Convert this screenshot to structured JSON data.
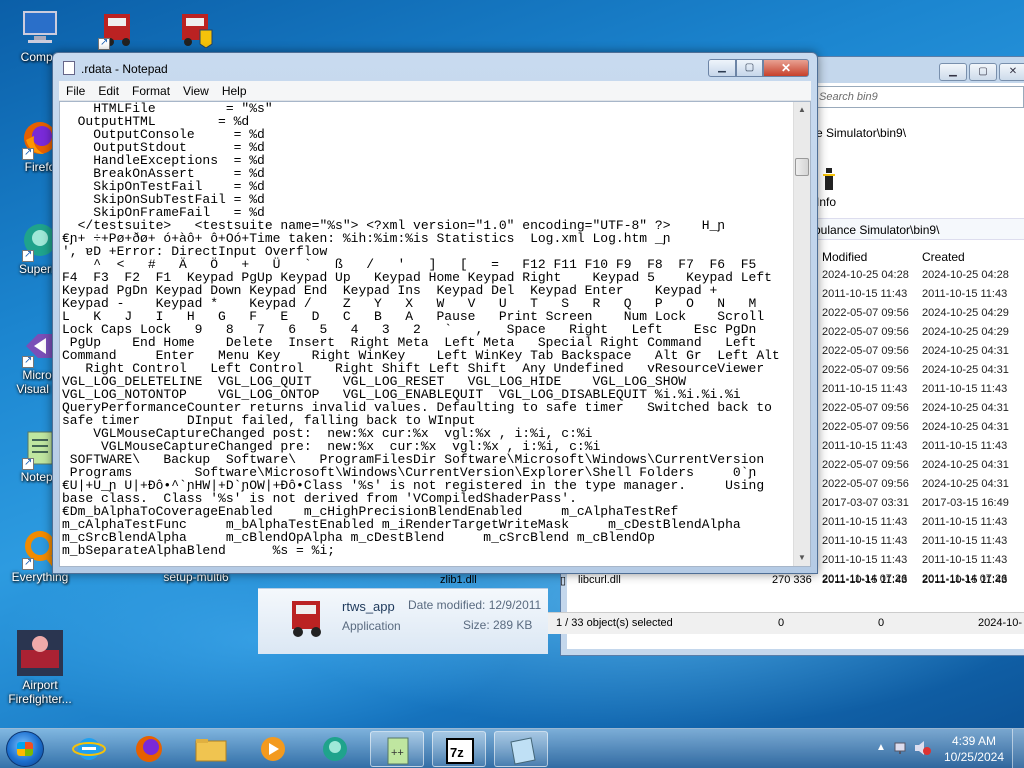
{
  "desktop_icons": [
    {
      "label": "Compu",
      "icon": "computer-icon"
    },
    {
      "label": "Firefo",
      "icon": "firefox-icon"
    },
    {
      "label": "Superm",
      "icon": "app-icon"
    },
    {
      "label": "Micros\nVisual St",
      "icon": "visual-studio-icon"
    },
    {
      "label": "Notepa",
      "icon": "notepad-icon"
    },
    {
      "label": "Everything",
      "icon": "everything-icon"
    },
    {
      "label": "setup-multi6",
      "icon": "setup-icon"
    },
    {
      "label": "Airport\nFirefighter...",
      "icon": "game-icon"
    }
  ],
  "notepad": {
    "title": ".rdata - Notepad",
    "menu": [
      "File",
      "Edit",
      "Format",
      "View",
      "Help"
    ],
    "lines": [
      "    HTMLFile         = \"%s\"",
      "  OutputHTML        = %d",
      "    OutputConsole     = %d",
      "    OutputStdout      = %d",
      "    HandleExceptions  = %d",
      "    BreakOnAssert     = %d",
      "    SkipOnTestFail    = %d",
      "    SkipOnSubTestFail = %d",
      "    SkipOnFrameFail   = %d",
      "  </testsuite>   <testsuite name=\"%s\"> <?xml version=\"1.0\" encoding=\"UTF-8\" ?>    H_ɲ",
      "€ɲ+ ÷+Pø+ðø+ ó+àô+ ô+Oó+Time taken: %ih:%im:%is Statistics  Log.xml Log.htm _ɲ",
      "', ɐD +Error: DirectInput Overflow",
      "    ^  <   #   Ä   Ö   +   Ü   `   ß   /   '   ]   [   =   F12 F11 F10 F9  F8  F7  F6  F5",
      "F4  F3  F2  F1  Keypad PgUp Keypad Up   Keypad Home Keypad Right    Keypad 5    Keypad Left",
      "Keypad PgDn Keypad Down Keypad End  Keypad Ins  Keypad Del  Keypad Enter    Keypad +",
      "Keypad -    Keypad *    Keypad /    Z   Y   X   W   V   U   T   S   R   Q   P   O   N   M",
      "L   K   J   I   H   G   F   E   D   C   B   A   Pause   Print Screen    Num Lock    Scroll",
      "Lock Caps Lock   9   8   7   6   5   4   3   2   `   ,   Space   Right   Left    Esc PgDn",
      " PgUp    End Home    Delete  Insert  Right Meta  Left Meta   Special Right Command   Left",
      "Command     Enter   Menu Key    Right WinKey    Left WinKey Tab Backspace   Alt Gr  Left Alt",
      "   Right Control   Left Control    Right Shift Left Shift  Any Undefined   vResourceViewer",
      "VGL_LOG_DELETELINE  VGL_LOG_QUIT    VGL_LOG_RESET   VGL_LOG_HIDE    VGL_LOG_SHOW",
      "VGL_LOG_NOTONTOP    VGL_LOG_ONTOP   VGL_LOG_ENABLEQUIT  VGL_LOG_DISABLEQUIT %i.%i.%i.%i",
      "QueryPerformanceCounter returns invalid values. Defaulting to safe timer   Switched back to",
      "safe timer      DInput failed, falling back to WInput",
      "    VGLMouseCaptureChanged post:  new:%x cur:%x  vgl:%x , i:%i, c:%i",
      "     VGLMouseCaptureChanged pre:  new:%x  cur:%x  vgl:%x , i:%i, c:%i",
      " SOFTWARE\\   Backup  Software\\   ProgramFilesDir Software\\Microsoft\\Windows\\CurrentVersion",
      " Programs        Software\\Microsoft\\Windows\\CurrentVersion\\Explorer\\Shell Folders     0`ɲ",
      "€U|+U_ɲ U|+Ðô•^`ɲHW|+D`ɲOW|+Ðô•Class '%s' is not registered in the type manager.     Using",
      "base class.  Class '%s' is not derived from 'VCompiledShaderPass'.",
      "€Dm_bAlphaToCoverageEnabled    m_cHighPrecisionBlendEnabled     m_cAlphaTestRef",
      "m_cAlphaTestFunc     m_bAlphaTestEnabled m_iRenderTargetWriteMask     m_cDestBlendAlpha",
      "m_cSrcBlendAlpha     m_cBlendOpAlpha m_cDestBlend     m_cSrcBlend m_cBlendOp",
      "m_bSeparateAlphaBlend      %s = %i;"
    ]
  },
  "explorer": {
    "search_placeholder": "Search bin9",
    "address_partial": "e Simulator\\bin9\\",
    "info_label": "Info",
    "path_partial": "bulance Simulator\\bin9\\",
    "columns": {
      "modified": "Modified",
      "created": "Created"
    },
    "rows": [
      {
        "modified": "2024-10-25 04:28",
        "created": "2024-10-25 04:28"
      },
      {
        "modified": "2011-10-15 11:43",
        "created": "2011-10-15 11:43"
      },
      {
        "modified": "2022-05-07 09:56",
        "created": "2024-10-25 04:29"
      },
      {
        "modified": "2022-05-07 09:56",
        "created": "2024-10-25 04:29"
      },
      {
        "modified": "2022-05-07 09:56",
        "created": "2024-10-25 04:31"
      },
      {
        "modified": "2022-05-07 09:56",
        "created": "2024-10-25 04:31"
      },
      {
        "modified": "2011-10-15 11:43",
        "created": "2011-10-15 11:43"
      },
      {
        "modified": "2022-05-07 09:56",
        "created": "2024-10-25 04:31"
      },
      {
        "modified": "2022-05-07 09:56",
        "created": "2024-10-25 04:31"
      },
      {
        "modified": "2011-10-15 11:43",
        "created": "2011-10-15 11:43"
      },
      {
        "modified": "2022-05-07 09:56",
        "created": "2024-10-25 04:31"
      },
      {
        "modified": "2022-05-07 09:56",
        "created": "2024-10-25 04:31"
      },
      {
        "modified": "2017-03-07 03:31",
        "created": "2017-03-15 16:49"
      },
      {
        "modified": "2011-10-15 11:43",
        "created": "2011-10-15 11:43"
      },
      {
        "modified": "2011-10-15 11:43",
        "created": "2011-10-15 11:43"
      },
      {
        "modified": "2011-10-15 11:43",
        "created": "2011-10-15 11:43"
      },
      {
        "modified": "2011-11-14 07:26",
        "created": "2011-11-14 07:26"
      }
    ],
    "bottom_files": [
      {
        "name": "zlib1.dll"
      },
      {
        "name": "libcurl.dll",
        "size": "270 336",
        "modified": "2011-10-15 11:43",
        "created": "2011-10-15 11:43"
      }
    ],
    "status": {
      "selected": "1 / 33 object(s) selected",
      "c1": "0",
      "c2": "0",
      "date": "2024-10-"
    },
    "details": {
      "name": "rtws_app",
      "type": "Application",
      "date_modified": "Date modified: 12/9/2011",
      "size": "Size: 289 KB"
    }
  },
  "taskbar": {
    "items": [
      "internet-explorer-icon",
      "firefox-icon",
      "file-explorer-icon",
      "media-player-icon",
      "app-icon",
      "notepad-plus-icon",
      "7zip-icon",
      "notepad-icon"
    ],
    "clock_time": "4:39 AM",
    "clock_date": "10/25/2024"
  }
}
